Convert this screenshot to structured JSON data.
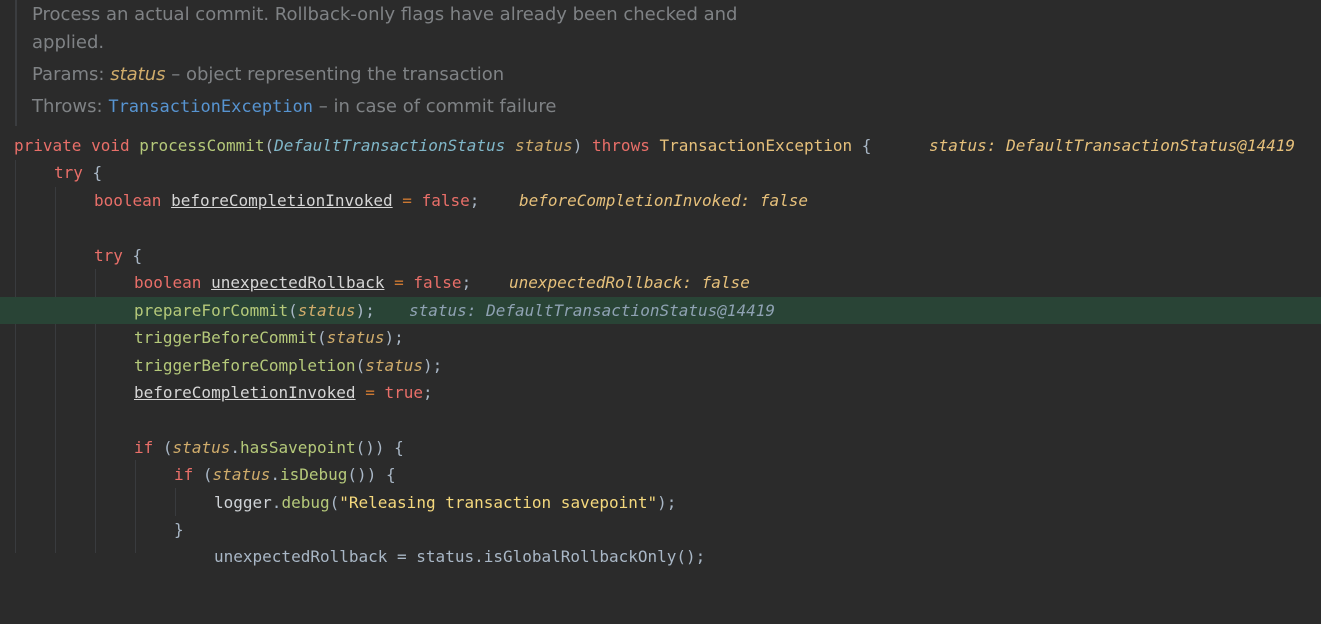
{
  "doc": {
    "line1": "Process an actual commit. Rollback-only flags have already been checked and",
    "line2": "applied.",
    "params_label": "Params:",
    "params_name": "status",
    "params_desc": " – object representing the transaction",
    "throws_label": "Throws:",
    "throws_type": "TransactionException",
    "throws_desc": " – in case of commit failure"
  },
  "code": {
    "private": "private",
    "void": "void",
    "method": "processCommit",
    "param_type": "DefaultTransactionStatus",
    "param_name": "status",
    "throws": "throws",
    "exception": "TransactionException",
    "sig_hint": "status: DefaultTransactionStatus@14419",
    "try": "try",
    "boolean": "boolean",
    "bci": "beforeCompletionInvoked",
    "false": "false",
    "true": "true",
    "bci_hint": "beforeCompletionInvoked: false",
    "ur": "unexpectedRollback",
    "ur_hint": "unexpectedRollback: false",
    "prepare": "prepareForCommit",
    "prepare_hint": "status: DefaultTransactionStatus@14419",
    "trigger_commit": "triggerBeforeCommit",
    "trigger_completion": "triggerBeforeCompletion",
    "if": "if",
    "has_savepoint": "hasSavepoint",
    "is_debug": "isDebug",
    "logger": "logger",
    "debug": "debug",
    "debug_msg": "\"Releasing transaction savepoint\"",
    "partial_line": "unexpectedRollback = status.isGlobalRollbackOnly();"
  }
}
